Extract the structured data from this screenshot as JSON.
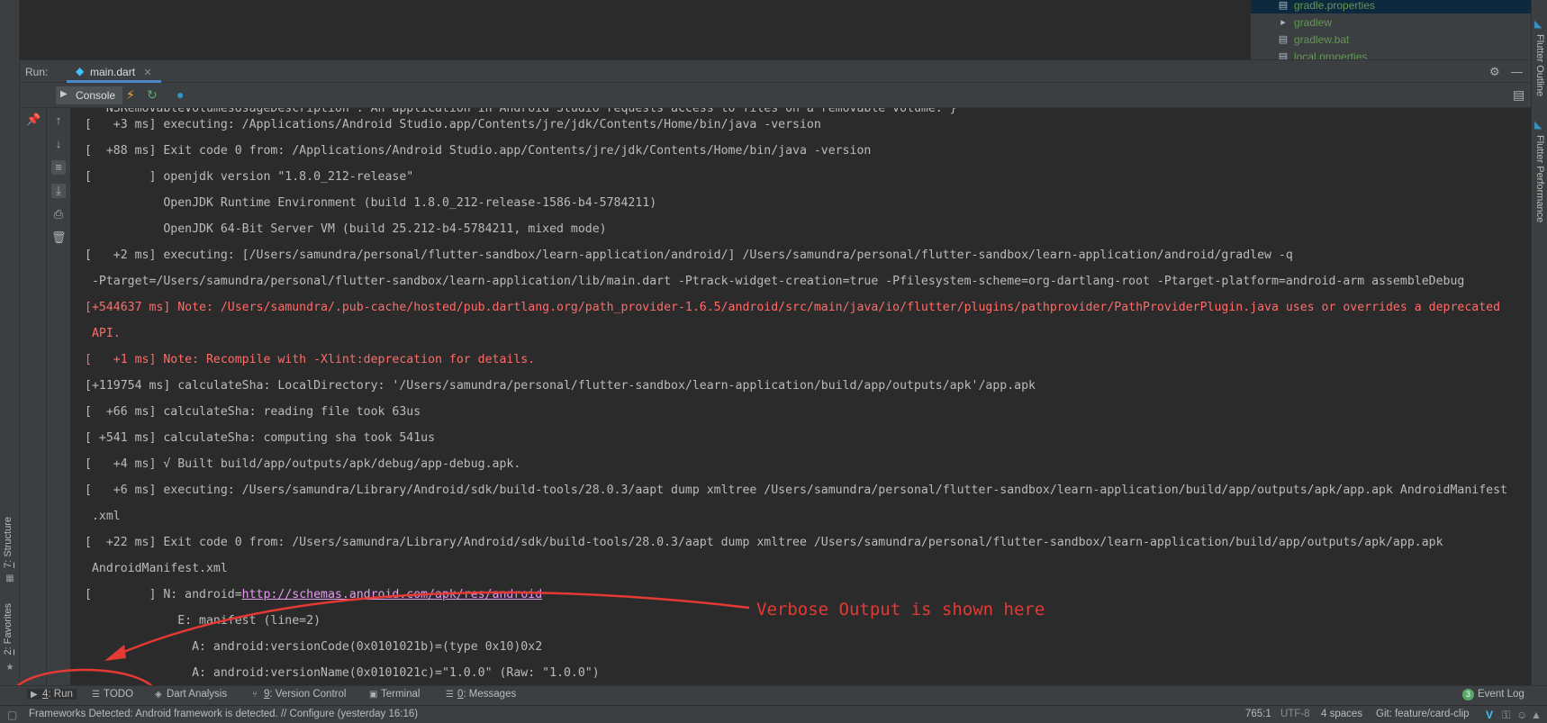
{
  "project": {
    "files": [
      {
        "name": "gradle.properties",
        "selected": true
      },
      {
        "name": "gradlew",
        "selected": false
      },
      {
        "name": "gradlew.bat",
        "selected": false
      },
      {
        "name": "local.properties",
        "selected": false
      }
    ]
  },
  "run_window": {
    "label": "Run:",
    "tab_label": "main.dart",
    "console_tab": "Console"
  },
  "left_tabs": {
    "structure": {
      "num": "7",
      "label": ": Structure"
    },
    "favorites": {
      "num": "2",
      "label": ": Favorites"
    }
  },
  "right_tabs": {
    "outline": "Flutter Outline",
    "performance": "Flutter Performance"
  },
  "console": {
    "lines": [
      {
        "text": "  \"NSRemovableVolumesUsageDescription\":\"An application in Android Studio requests access to files on a removable volume.\"}",
        "type": "normal"
      },
      {
        "text": "[   +3 ms] executing: /Applications/Android Studio.app/Contents/jre/jdk/Contents/Home/bin/java -version",
        "type": "normal"
      },
      {
        "text": "[  +88 ms] Exit code 0 from: /Applications/Android Studio.app/Contents/jre/jdk/Contents/Home/bin/java -version",
        "type": "normal"
      },
      {
        "text": "[        ] openjdk version \"1.8.0_212-release\"",
        "type": "normal"
      },
      {
        "text": "           OpenJDK Runtime Environment (build 1.8.0_212-release-1586-b4-5784211)",
        "type": "normal"
      },
      {
        "text": "           OpenJDK 64-Bit Server VM (build 25.212-b4-5784211, mixed mode)",
        "type": "normal"
      },
      {
        "text": "[   +2 ms] executing: [/Users/samundra/personal/flutter-sandbox/learn-application/android/] /Users/samundra/personal/flutter-sandbox/learn-application/android/gradlew -q",
        "type": "normal"
      },
      {
        "text": " -Ptarget=/Users/samundra/personal/flutter-sandbox/learn-application/lib/main.dart -Ptrack-widget-creation=true -Pfilesystem-scheme=org-dartlang-root -Ptarget-platform=android-arm assembleDebug",
        "type": "normal"
      },
      {
        "text": "[+544637 ms] Note: /Users/samundra/.pub-cache/hosted/pub.dartlang.org/path_provider-1.6.5/android/src/main/java/io/flutter/plugins/pathprovider/PathProviderPlugin.java uses or overrides a deprecated",
        "type": "err"
      },
      {
        "text": " API.",
        "type": "err"
      },
      {
        "text": "[   +1 ms] Note: Recompile with -Xlint:deprecation for details.",
        "type": "err"
      },
      {
        "text": "[+119754 ms] calculateSha: LocalDirectory: '/Users/samundra/personal/flutter-sandbox/learn-application/build/app/outputs/apk'/app.apk",
        "type": "normal"
      },
      {
        "text": "[  +66 ms] calculateSha: reading file took 63us",
        "type": "normal"
      },
      {
        "text": "[ +541 ms] calculateSha: computing sha took 541us",
        "type": "normal"
      },
      {
        "text": "[   +4 ms] √ Built build/app/outputs/apk/debug/app-debug.apk.",
        "type": "normal"
      },
      {
        "text": "[   +6 ms] executing: /Users/samundra/Library/Android/sdk/build-tools/28.0.3/aapt dump xmltree /Users/samundra/personal/flutter-sandbox/learn-application/build/app/outputs/apk/app.apk AndroidManifest",
        "type": "normal"
      },
      {
        "text": " .xml",
        "type": "normal"
      },
      {
        "text": "[  +22 ms] Exit code 0 from: /Users/samundra/Library/Android/sdk/build-tools/28.0.3/aapt dump xmltree /Users/samundra/personal/flutter-sandbox/learn-application/build/app/outputs/apk/app.apk",
        "type": "normal"
      },
      {
        "text": " AndroidManifest.xml",
        "type": "normal"
      },
      {
        "text": "             E: manifest (line=2)",
        "type": "normal"
      },
      {
        "text": "               A: android:versionCode(0x0101021b)=(type 0x10)0x2",
        "type": "normal"
      },
      {
        "text": "               A: android:versionName(0x0101021c)=\"1.0.0\" (Raw: \"1.0.0\")",
        "type": "normal"
      }
    ],
    "link_line": {
      "prefix": "[        ] N: android=",
      "link": "http://schemas.android.com/apk/res/android"
    }
  },
  "annotation": {
    "text": "Verbose Output is shown here",
    "color": "#e53935"
  },
  "bottom_tabs": {
    "run": {
      "num": "4",
      "label": ": Run"
    },
    "todo": "TODO",
    "dart_analysis": "Dart Analysis",
    "version_control": {
      "num": "9",
      "label": ": Version Control"
    },
    "terminal": "Terminal",
    "messages": {
      "num": "0",
      "label": ": Messages"
    },
    "event_log": {
      "count": "3",
      "label": "Event Log"
    }
  },
  "status": {
    "message": "Frameworks Detected: Android framework is detected. // Configure (yesterday 16:16)",
    "position": "765:1",
    "encoding": "UTF-8",
    "indent": "4 spaces",
    "git": "Git: feature/card-clip"
  },
  "colors": {
    "error_text": "#ff6b68",
    "link_text": "#e69af0",
    "accent": "#4a88c7"
  }
}
